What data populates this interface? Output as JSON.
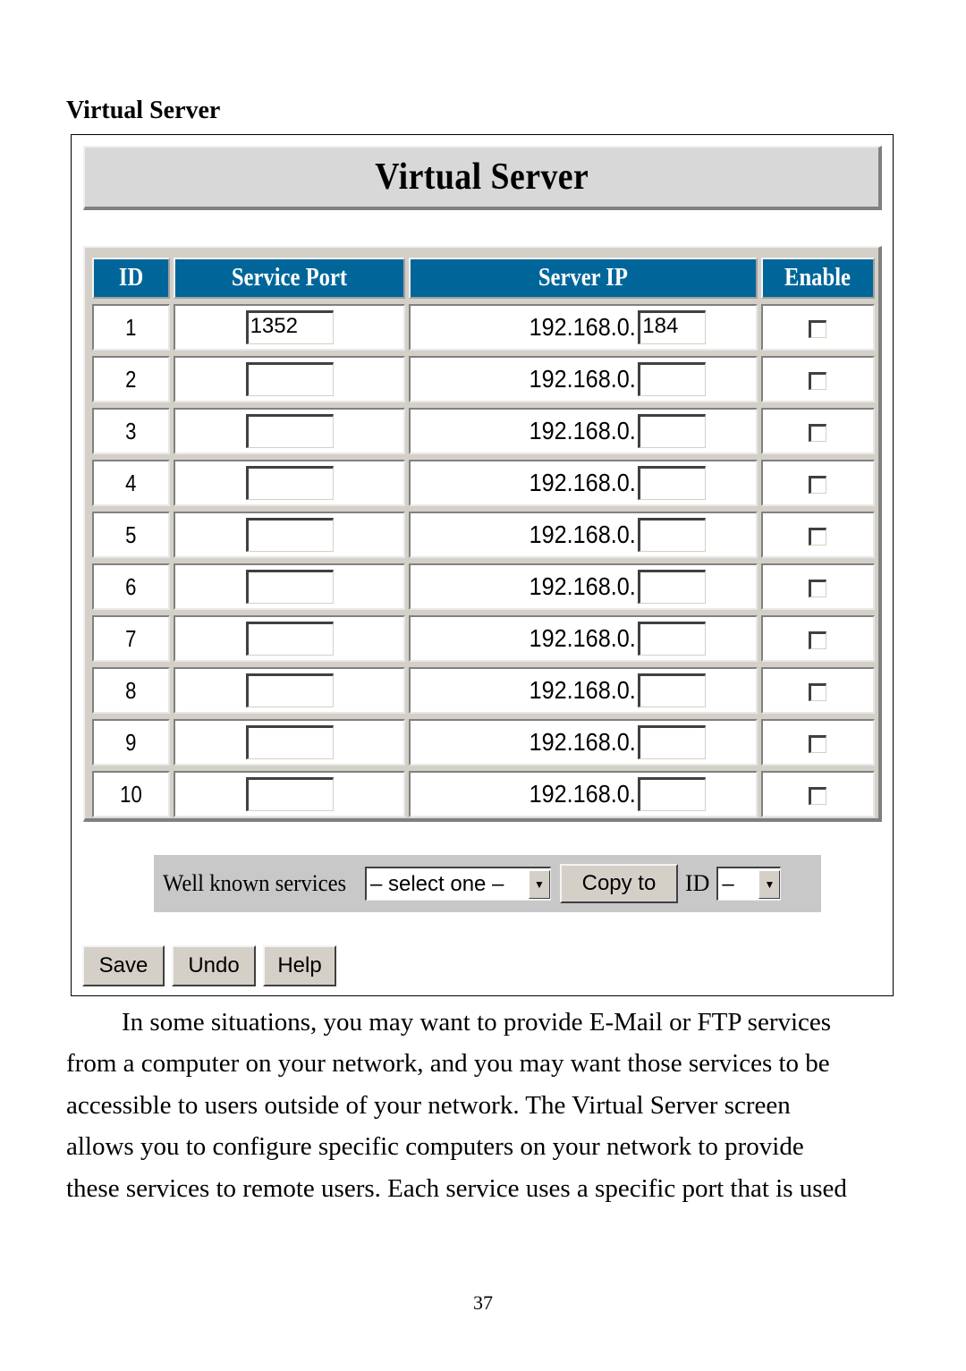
{
  "section_heading": "Virtual Server",
  "panel": {
    "title": "Virtual Server",
    "columns": [
      "ID",
      "Service Port",
      "Server IP",
      "Enable"
    ],
    "ip_prefix": "192.168.0.",
    "rows": [
      {
        "id": "1",
        "service_port": "1352",
        "ip_suffix": "184",
        "enabled": false
      },
      {
        "id": "2",
        "service_port": "",
        "ip_suffix": "",
        "enabled": false
      },
      {
        "id": "3",
        "service_port": "",
        "ip_suffix": "",
        "enabled": false
      },
      {
        "id": "4",
        "service_port": "",
        "ip_suffix": "",
        "enabled": false
      },
      {
        "id": "5",
        "service_port": "",
        "ip_suffix": "",
        "enabled": false
      },
      {
        "id": "6",
        "service_port": "",
        "ip_suffix": "",
        "enabled": false
      },
      {
        "id": "7",
        "service_port": "",
        "ip_suffix": "",
        "enabled": false
      },
      {
        "id": "8",
        "service_port": "",
        "ip_suffix": "",
        "enabled": false
      },
      {
        "id": "9",
        "service_port": "",
        "ip_suffix": "",
        "enabled": false
      },
      {
        "id": "10",
        "service_port": "",
        "ip_suffix": "",
        "enabled": false
      }
    ],
    "well_known": {
      "label": "Well known services",
      "select_value": "– select one –",
      "copy_button": "Copy to",
      "id_label": "ID",
      "id_select_value": "–"
    },
    "buttons": {
      "save": "Save",
      "undo": "Undo",
      "help": "Help"
    }
  },
  "paragraph_lines": [
    "In some situations, you may want to provide E-Mail or FTP services",
    "from a computer on your network, and you may want those services to be",
    "accessible to users outside of your network. The Virtual Server screen",
    "allows you to configure specific computers on your network to provide",
    "these services to remote users. Each service uses a specific port that is used"
  ],
  "page_number": "37"
}
